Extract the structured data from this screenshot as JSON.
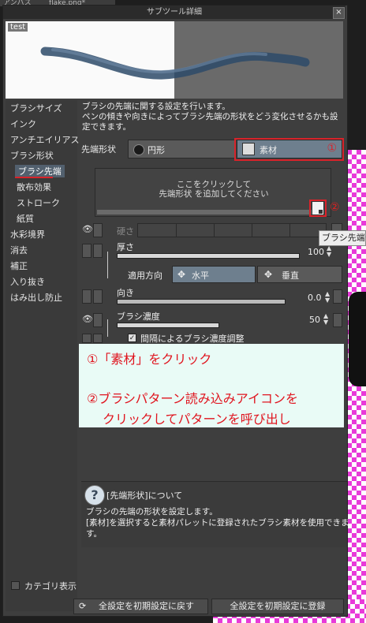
{
  "background": {
    "tabs": [
      "アンバス",
      "flake.png*"
    ]
  },
  "dialog": {
    "title": "サブツール詳細",
    "close": "×",
    "preview_label": "test"
  },
  "sidebar": {
    "items": [
      {
        "label": "ブラシサイズ",
        "sub": false,
        "selected": false
      },
      {
        "label": "インク",
        "sub": false,
        "selected": false
      },
      {
        "label": "アンチエイリアス",
        "sub": false,
        "selected": false
      },
      {
        "label": "ブラシ形状",
        "sub": false,
        "selected": false
      },
      {
        "label": "ブラシ先端",
        "sub": true,
        "selected": true
      },
      {
        "label": "散布効果",
        "sub": true,
        "selected": false
      },
      {
        "label": "ストローク",
        "sub": true,
        "selected": false
      },
      {
        "label": "紙質",
        "sub": true,
        "selected": false
      },
      {
        "label": "水彩境界",
        "sub": false,
        "selected": false
      },
      {
        "label": "消去",
        "sub": false,
        "selected": false
      },
      {
        "label": "補正",
        "sub": false,
        "selected": false
      },
      {
        "label": "入り抜き",
        "sub": false,
        "selected": false
      },
      {
        "label": "はみ出し防止",
        "sub": false,
        "selected": false
      }
    ],
    "category_label": "カテゴリ表示"
  },
  "main": {
    "description": [
      "ブラシの先端に関する設定を行います。",
      "ペンの傾きや向きによってブラシ先端の形状をどう変化させるかも設",
      "定できます。"
    ],
    "tip_shape": {
      "label": "先端形状",
      "circle": "円形",
      "material": "素材",
      "material_marker": "①"
    },
    "add_area": {
      "line1": "ここをクリックして",
      "line2": "先端形状 を追加してください",
      "marker": "②"
    },
    "hardness": {
      "label": "硬さ"
    },
    "thickness": {
      "label": "厚さ",
      "value": "100",
      "direction_label": "適用方向",
      "horizontal": "水平",
      "vertical": "垂直"
    },
    "direction": {
      "label": "向き",
      "value": "0.0"
    },
    "density": {
      "label": "ブラシ濃度",
      "value": "50",
      "interval_label": "間隔によるブラシ濃度調整"
    }
  },
  "note": {
    "line1": "①「素材」をクリック",
    "line2": "②ブラシパターン読み込みアイコンを",
    "line3": "クリックしてパターンを呼び出し"
  },
  "help": {
    "title": "[先端形状]について",
    "line1": "ブラシの先端の形状を設定します。",
    "line2": "[素材]を選択すると素材パレットに登録されたブラシ素材を使用できま",
    "line3": "す。"
  },
  "footer": {
    "reset": "全設定を初期設定に戻す",
    "register": "全設定を初期設定に登録"
  },
  "tooltip": "ブラシ先端",
  "colors": {
    "accent_red": "#d8232a",
    "note_bg": "#e9fbf6",
    "selected": "#52606e"
  }
}
